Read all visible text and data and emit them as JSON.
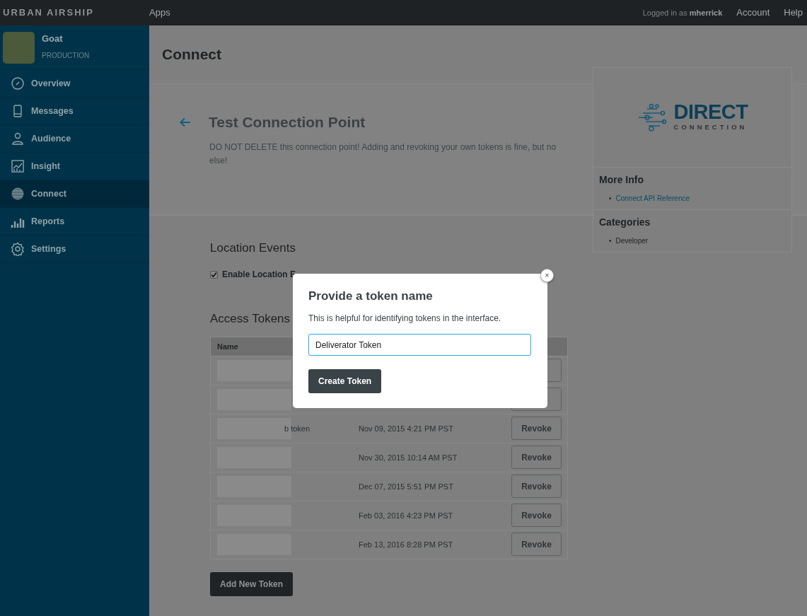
{
  "topbar": {
    "brand": "URBAN AIRSHIP",
    "apps": "Apps",
    "logged_in_prefix": "Logged in as",
    "user": "mherrick",
    "links": [
      "Account",
      "Help"
    ]
  },
  "app": {
    "name": "Goat",
    "environment": "PRODUCTION"
  },
  "sidebar": {
    "items": [
      {
        "label": "Overview",
        "selected": false
      },
      {
        "label": "Messages",
        "selected": false
      },
      {
        "label": "Audience",
        "selected": false
      },
      {
        "label": "Insight",
        "selected": false
      },
      {
        "label": "Connect",
        "selected": true
      },
      {
        "label": "Reports",
        "selected": false
      },
      {
        "label": "Settings",
        "selected": false
      }
    ]
  },
  "page": {
    "title": "Connect",
    "connection_title": "Test Connection Point",
    "description": "DO NOT DELETE this connection point! Adding and revoking your own tokens is fine, but no else!"
  },
  "location": {
    "heading": "Location Events",
    "checkbox_label": "Enable Location E",
    "checked": true
  },
  "tokens": {
    "heading": "Access Tokens",
    "columns": [
      "Name"
    ],
    "rows": [
      {
        "name": "",
        "date": "",
        "action": ""
      },
      {
        "name": "",
        "date": "",
        "action": ""
      },
      {
        "name": "b token",
        "date": "Nov 09, 2015 4:21 PM PST",
        "action": "Revoke"
      },
      {
        "name": "",
        "date": "Nov 30, 2015 10:14 AM PST",
        "action": "Revoke"
      },
      {
        "name": "",
        "date": "Dec 07, 2015 5:51 PM PST",
        "action": "Revoke"
      },
      {
        "name": "",
        "date": "Feb 03, 2016 4:23 PM PST",
        "action": "Revoke"
      },
      {
        "name": "",
        "date": "Feb 13, 2016 8:28 PM PST",
        "action": "Revoke"
      }
    ],
    "add_button": "Add New Token"
  },
  "side_card": {
    "logo_word": "DIRECT",
    "logo_sub": "CONNECTION",
    "more_info_heading": "More Info",
    "links": [
      {
        "bullet": "•",
        "text": "Connect API Reference"
      }
    ],
    "categories_heading": "Categories",
    "categories": [
      {
        "bullet": "•",
        "text": "Developer"
      }
    ]
  },
  "modal": {
    "title": "Provide a token name",
    "help": "This is helpful for identifying tokens in the interface.",
    "value": "Deliverator Token",
    "submit": "Create Token",
    "close": "×"
  }
}
